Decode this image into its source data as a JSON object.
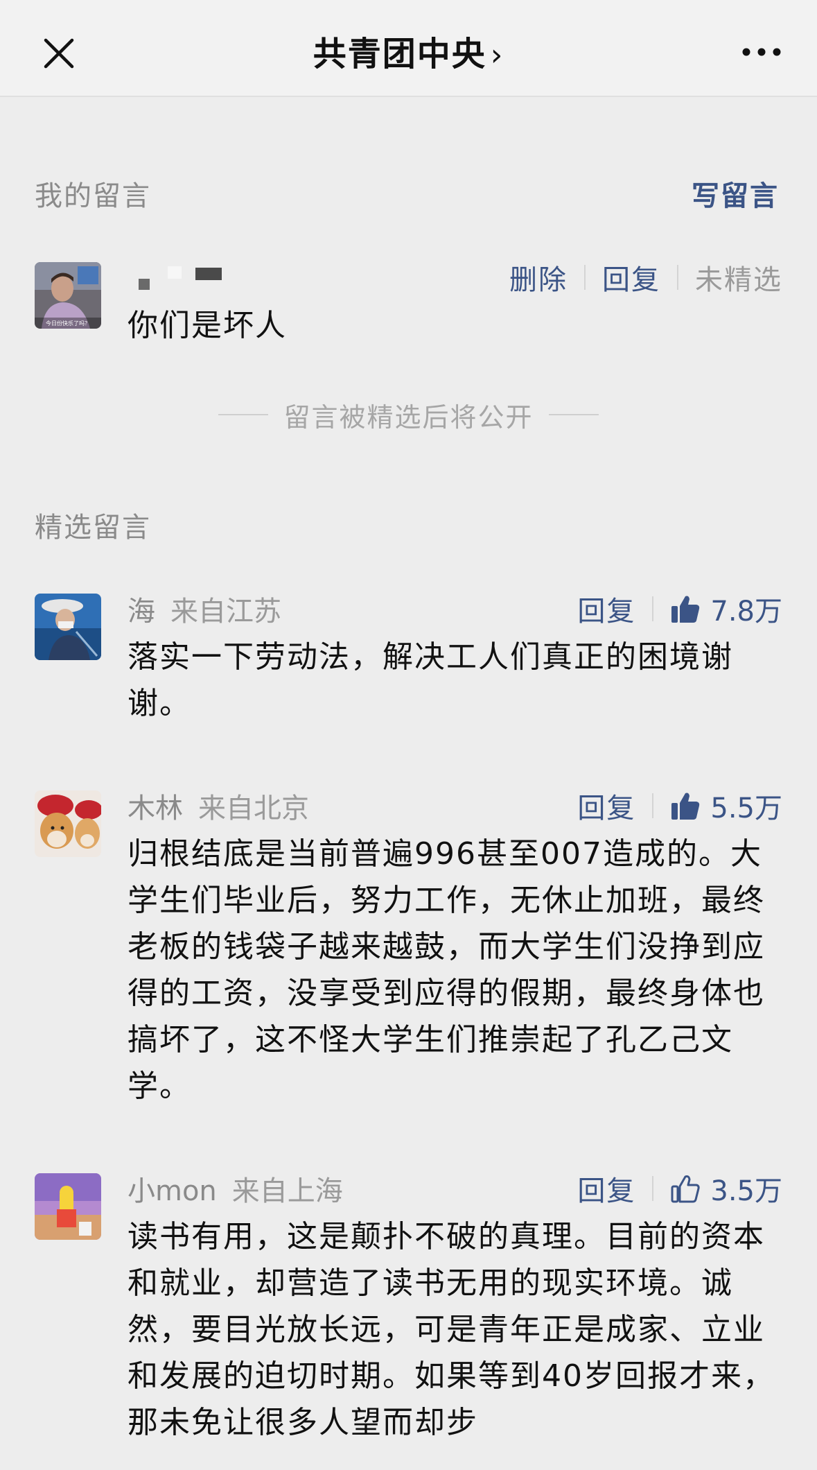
{
  "header": {
    "title": "共青团中央",
    "chevron": "›"
  },
  "my_comment_section": {
    "label": "我的留言",
    "write_label": "写留言",
    "comment": {
      "avatar_caption": "今日份快乐了吗？",
      "text": "你们是坏人",
      "actions": {
        "delete": "删除",
        "reply": "回复",
        "status": "未精选"
      }
    },
    "notice": "留言被精选后将公开"
  },
  "featured_section": {
    "label": "精选留言",
    "comments": [
      {
        "name": "海",
        "location": "来自江苏",
        "reply": "回复",
        "likes": "7.8万",
        "liked": true,
        "text": "落实一下劳动法，解决工人们真正的困境谢谢。"
      },
      {
        "name": "木林",
        "location": "来自北京",
        "reply": "回复",
        "likes": "5.5万",
        "liked": true,
        "text": "归根结底是当前普遍996甚至007造成的。大学生们毕业后，努力工作，无休止加班，最终老板的钱袋子越来越鼓，而大学生们没挣到应得的工资，没享受到应得的假期，最终身体也搞坏了，这不怪大学生们推崇起了孔乙己文学。"
      },
      {
        "name": "小mon",
        "location": "来自上海",
        "reply": "回复",
        "likes": "3.5万",
        "liked": false,
        "text": "读书有用，这是颠扑不破的真理。目前的资本和就业，却营造了读书无用的现实环境。诚然，要目光放长远，可是青年正是成家、立业和发展的迫切时期。如果等到40岁回报才来，那未免让很多人望而却步"
      }
    ]
  },
  "colors": {
    "background": "#ededed",
    "link": "#3b5486",
    "muted": "#8a8a8a"
  },
  "icons": {
    "close": "close-icon",
    "more": "more-icon",
    "thumb_filled": "thumbs-up-filled-icon",
    "thumb_outline": "thumbs-up-outline-icon"
  }
}
